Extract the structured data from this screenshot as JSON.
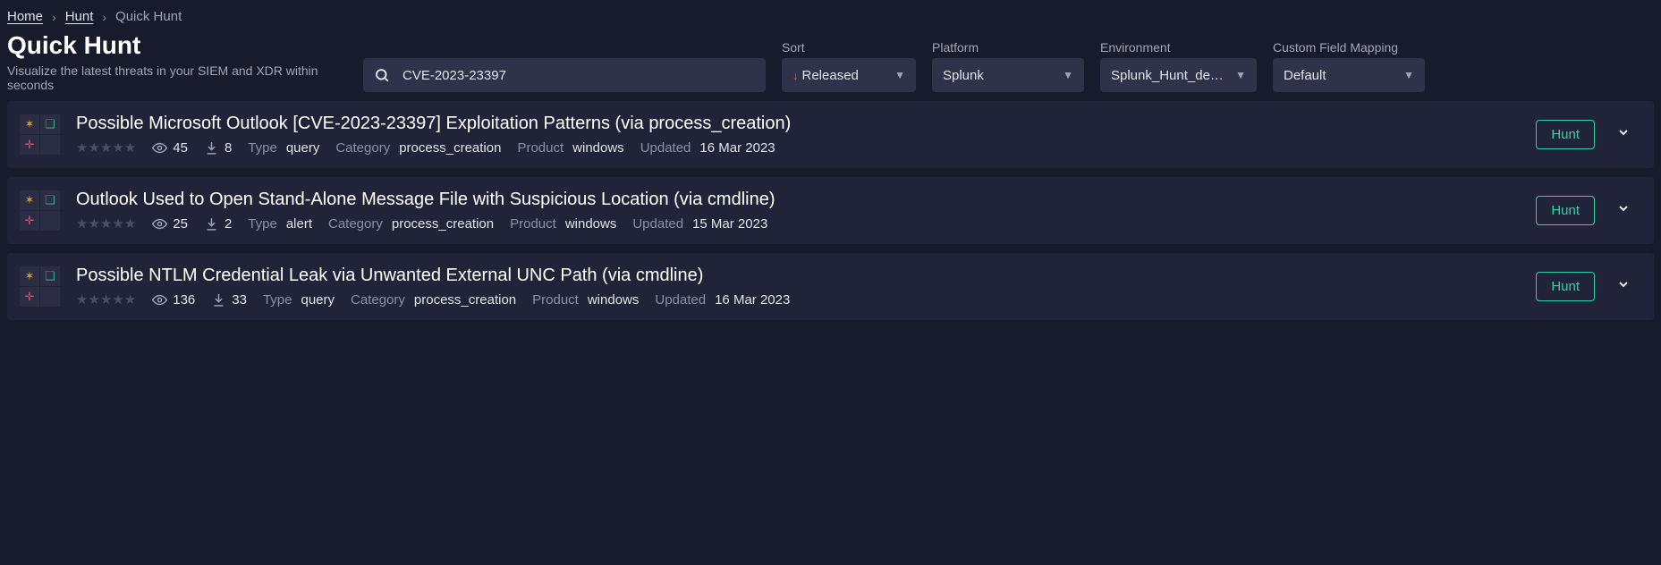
{
  "breadcrumb": {
    "home": "Home",
    "hunt": "Hunt",
    "current": "Quick Hunt"
  },
  "page": {
    "title": "Quick Hunt",
    "subtitle": "Visualize the latest threats in your SIEM and XDR within seconds"
  },
  "search": {
    "value": "CVE-2023-23397"
  },
  "filters": {
    "sort": {
      "label": "Sort",
      "value": "Released"
    },
    "platform": {
      "label": "Platform",
      "value": "Splunk"
    },
    "environment": {
      "label": "Environment",
      "value": "Splunk_Hunt_dem..."
    },
    "cfm": {
      "label": "Custom Field Mapping",
      "value": "Default"
    }
  },
  "labels": {
    "type": "Type",
    "category": "Category",
    "product": "Product",
    "updated": "Updated",
    "hunt": "Hunt"
  },
  "items": [
    {
      "title": "Possible Microsoft Outlook [CVE-2023-23397] Exploitation Patterns (via process_creation)",
      "views": "45",
      "downloads": "8",
      "type": "query",
      "category": "process_creation",
      "product": "windows",
      "updated": "16 Mar 2023"
    },
    {
      "title": "Outlook Used to Open Stand-Alone Message File with Suspicious Location (via cmdline)",
      "views": "25",
      "downloads": "2",
      "type": "alert",
      "category": "process_creation",
      "product": "windows",
      "updated": "15 Mar 2023"
    },
    {
      "title": "Possible NTLM Credential Leak via Unwanted External UNC Path (via cmdline)",
      "views": "136",
      "downloads": "33",
      "type": "query",
      "category": "process_creation",
      "product": "windows",
      "updated": "16 Mar 2023"
    }
  ]
}
